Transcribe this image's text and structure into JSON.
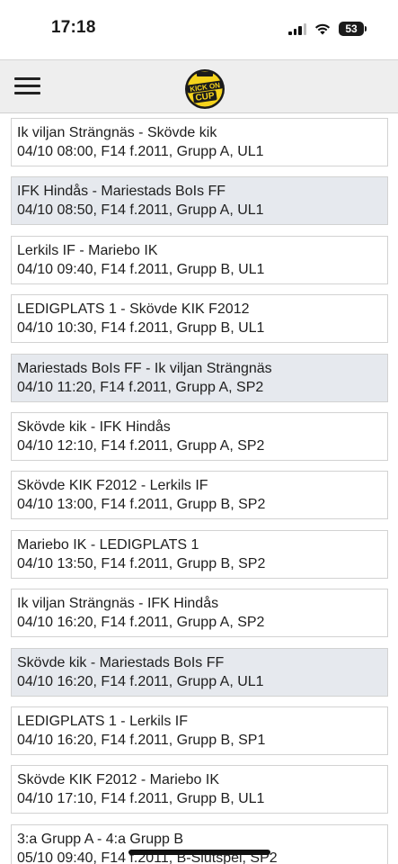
{
  "status_bar": {
    "time": "17:18",
    "battery": "53"
  },
  "header": {
    "menu_icon": "hamburger-menu-icon",
    "logo": "kick-on-cup-logo",
    "logo_text_top": "KICK ON",
    "logo_text_bottom": "CUP"
  },
  "matches": [
    {
      "title": "Ik viljan Strängnäs - Skövde kik",
      "info": "04/10 08:00, F14 f.2011, Grupp A, UL1",
      "shaded": false
    },
    {
      "title": "IFK Hindås - Mariestads BoIs FF",
      "info": "04/10 08:50, F14 f.2011, Grupp A, UL1",
      "shaded": true
    },
    {
      "title": "Lerkils IF - Mariebo IK",
      "info": "04/10 09:40, F14 f.2011, Grupp B, UL1",
      "shaded": false
    },
    {
      "title": "LEDIGPLATS 1 - Skövde KIK F2012",
      "info": "04/10 10:30, F14 f.2011, Grupp B, UL1",
      "shaded": false
    },
    {
      "title": "Mariestads BoIs FF - Ik viljan Strängnäs",
      "info": "04/10 11:20, F14 f.2011, Grupp A, SP2",
      "shaded": true
    },
    {
      "title": "Skövde kik - IFK Hindås",
      "info": "04/10 12:10, F14 f.2011, Grupp A, SP2",
      "shaded": false
    },
    {
      "title": "Skövde KIK F2012 - Lerkils IF",
      "info": "04/10 13:00, F14 f.2011, Grupp B, SP2",
      "shaded": false
    },
    {
      "title": "Mariebo IK - LEDIGPLATS 1",
      "info": "04/10 13:50, F14 f.2011, Grupp B, SP2",
      "shaded": false
    },
    {
      "title": "Ik viljan Strängnäs - IFK Hindås",
      "info": "04/10 16:20, F14 f.2011, Grupp A, SP2",
      "shaded": false
    },
    {
      "title": "Skövde kik - Mariestads BoIs FF",
      "info": "04/10 16:20, F14 f.2011, Grupp A, UL1",
      "shaded": true
    },
    {
      "title": "LEDIGPLATS 1 - Lerkils IF",
      "info": "04/10 16:20, F14 f.2011, Grupp B, SP1",
      "shaded": false
    },
    {
      "title": "Skövde KIK F2012 - Mariebo IK",
      "info": "04/10 17:10, F14 f.2011, Grupp B, UL1",
      "shaded": false
    },
    {
      "title": "3:a Grupp A - 4:a Grupp B",
      "info": "05/10 09:40, F14 f.2011, B-Slutspel, SP2",
      "shaded": false
    }
  ],
  "colors": {
    "header_bg": "#eeeeee",
    "row_shaded": "#e6e9ee",
    "logo_yellow": "#f5d31c"
  }
}
